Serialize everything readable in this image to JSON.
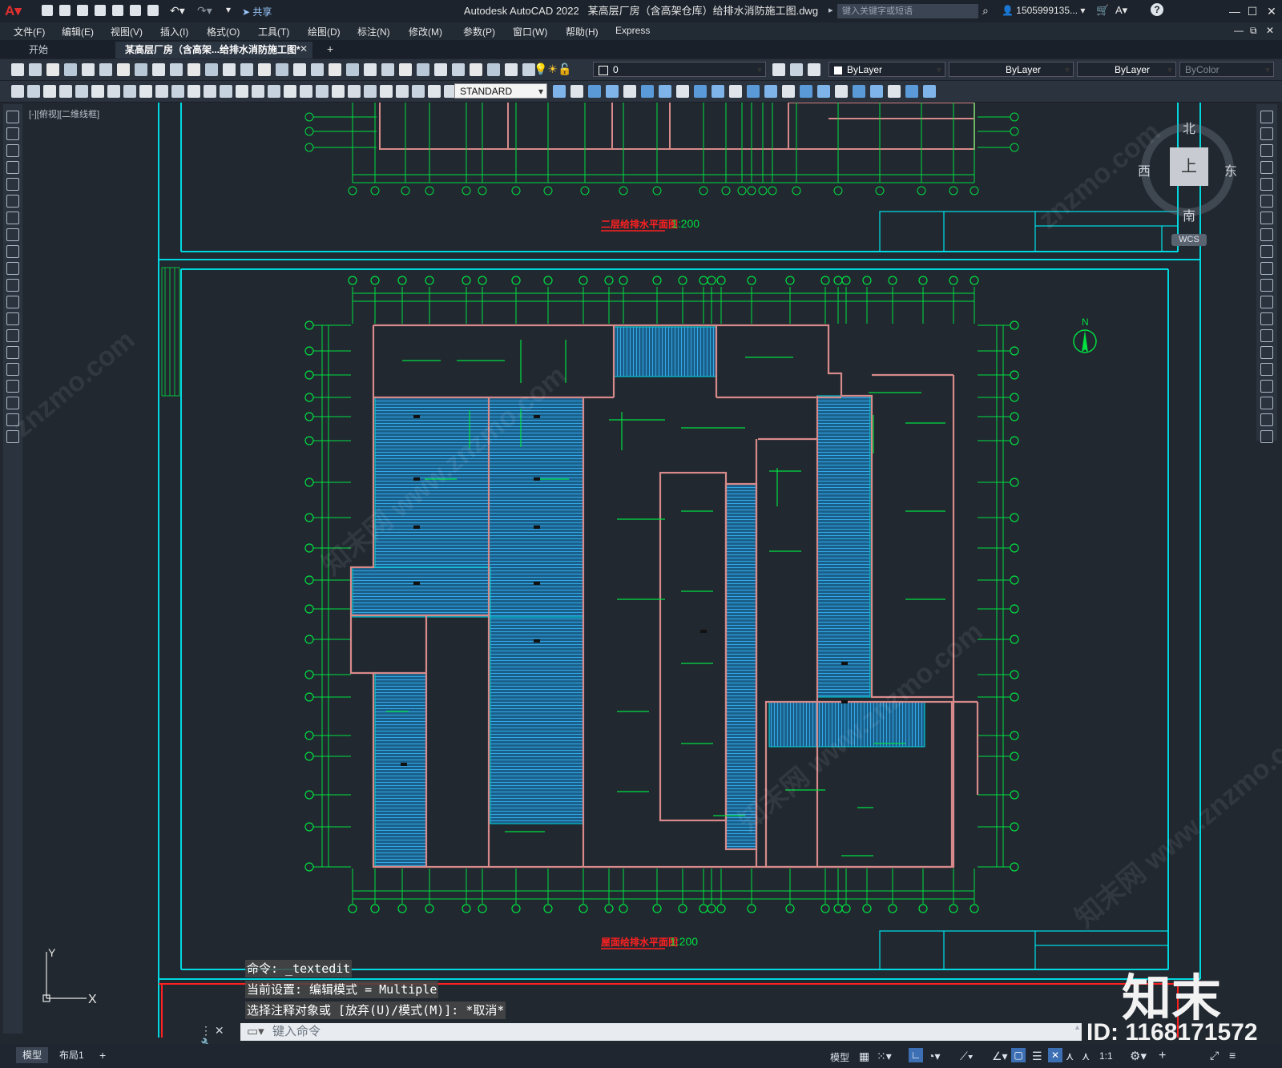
{
  "title_bar": {
    "app_name": "Autodesk AutoCAD 2022",
    "file_name": "某高层厂房（含高架仓库）给排水消防施工图.dwg",
    "share_label": "共享",
    "search_placeholder": "键入关键字或短语",
    "user": "1505999135...",
    "arrow": "▸"
  },
  "menu": [
    "文件(F)",
    "编辑(E)",
    "视图(V)",
    "插入(I)",
    "格式(O)",
    "工具(T)",
    "绘图(D)",
    "标注(N)",
    "修改(M)",
    "参数(P)",
    "窗口(W)",
    "帮助(H)",
    "Express"
  ],
  "tabs": {
    "start": "开始",
    "active": "某高层厂房（含高架...给排水消防施工图*",
    "add": "+"
  },
  "toolbar": {
    "layer_value": "0",
    "color_value": "ByLayer",
    "linetype_value": "ByLayer",
    "lineweight_value": "ByLayer",
    "plotstyle_value": "ByColor",
    "text_style": "STANDARD"
  },
  "viewport_label": "[-][俯视][二维线框]",
  "viewcube": {
    "north": "北",
    "south": "南",
    "east": "东",
    "west": "西",
    "top": "上",
    "wcs": "WCS"
  },
  "drawing": {
    "plan1_title": "二层给排水平面图",
    "plan1_scale": "1:200",
    "plan2_title": "屋面给排水平面图",
    "plan2_scale": "1:200",
    "north_label": "N",
    "ucs_y": "Y",
    "ucs_x": "X"
  },
  "command": {
    "line1": "命令: _textedit",
    "line2": "当前设置: 编辑模式 = Multiple",
    "line3": "选择注释对象或 [放弃(U)/模式(M)]: *取消*",
    "placeholder": "键入命令"
  },
  "status_bar": {
    "model_tab": "模型",
    "layout_tab": "布局1",
    "add": "+",
    "model_button": "模型",
    "scale": "1:1"
  },
  "watermark": {
    "brand": "知末",
    "id": "ID: 1168171572",
    "site": "znzmo.com",
    "site_cn": "知末网 www.znzmo.com"
  },
  "colors": {
    "background": "#212830",
    "grid_line": "#00e040",
    "frame": "#00d8e0",
    "wall": "#d88a8a",
    "hatch": "#1c78a8",
    "title_red": "#ff2020"
  }
}
